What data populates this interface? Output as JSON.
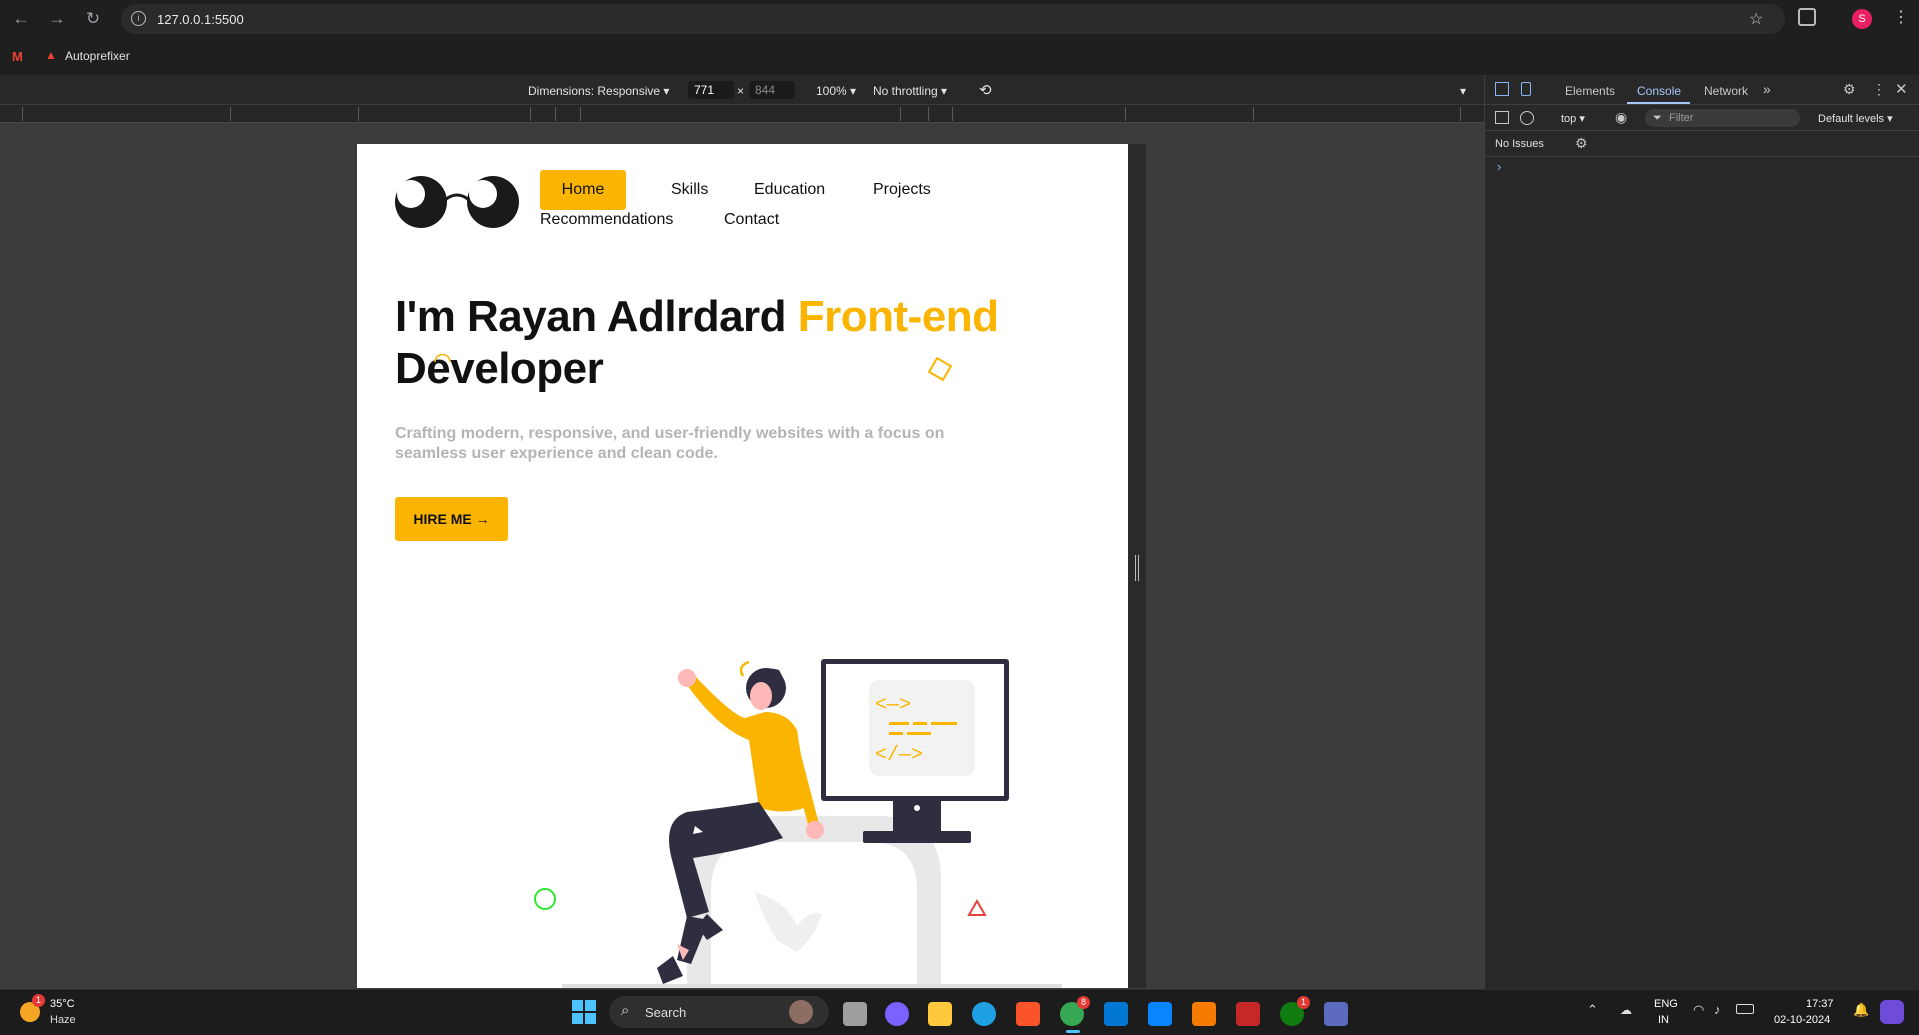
{
  "browser": {
    "url": "127.0.0.1:5500",
    "profile_initial": "S",
    "bookmarks": [
      {
        "label": "Autoprefixer"
      }
    ]
  },
  "devtools_toolbar": {
    "dimensions_label": "Dimensions: Responsive",
    "width": "771",
    "times": "×",
    "height": "844",
    "zoom": "100%",
    "throttling": "No throttling"
  },
  "devtools": {
    "tabs": [
      "Elements",
      "Console",
      "Network"
    ],
    "active_tab": "Console",
    "context": "top",
    "filter_placeholder": "Filter",
    "levels": "Default levels",
    "issues": "No Issues",
    "prompt": "›"
  },
  "site": {
    "nav": {
      "home": "Home",
      "skills": "Skills",
      "education": "Education",
      "projects": "Projects",
      "recommendations": "Recommendations",
      "contact": "Contact"
    },
    "hero": {
      "title_main": "I'm Rayan Adlrdard ",
      "title_accent": "Front-end",
      "title_end": "Developer",
      "description": "Crafting modern, responsive, and user-friendly websites with a focus on seamless user experience and clean code.",
      "cta": "HIRE ME →"
    },
    "accent_color": "#fbb400"
  },
  "taskbar": {
    "weather_temp": "35°C",
    "weather_desc": "Haze",
    "weather_badge": "1",
    "search_label": "Search",
    "lang_top": "ENG",
    "lang_bottom": "IN",
    "time": "17:37",
    "date": "02-10-2024",
    "chrome_badge": "8",
    "xbox_badge": "1"
  }
}
